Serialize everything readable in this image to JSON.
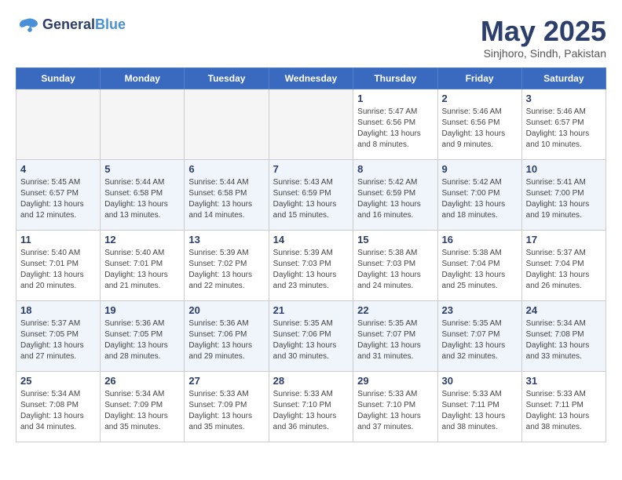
{
  "logo": {
    "line1": "General",
    "line2": "Blue"
  },
  "title": "May 2025",
  "location": "Sinjhoro, Sindh, Pakistan",
  "days_of_week": [
    "Sunday",
    "Monday",
    "Tuesday",
    "Wednesday",
    "Thursday",
    "Friday",
    "Saturday"
  ],
  "weeks": [
    [
      {
        "day": "",
        "info": ""
      },
      {
        "day": "",
        "info": ""
      },
      {
        "day": "",
        "info": ""
      },
      {
        "day": "",
        "info": ""
      },
      {
        "day": "1",
        "info": "Sunrise: 5:47 AM\nSunset: 6:56 PM\nDaylight: 13 hours\nand 8 minutes."
      },
      {
        "day": "2",
        "info": "Sunrise: 5:46 AM\nSunset: 6:56 PM\nDaylight: 13 hours\nand 9 minutes."
      },
      {
        "day": "3",
        "info": "Sunrise: 5:46 AM\nSunset: 6:57 PM\nDaylight: 13 hours\nand 10 minutes."
      }
    ],
    [
      {
        "day": "4",
        "info": "Sunrise: 5:45 AM\nSunset: 6:57 PM\nDaylight: 13 hours\nand 12 minutes."
      },
      {
        "day": "5",
        "info": "Sunrise: 5:44 AM\nSunset: 6:58 PM\nDaylight: 13 hours\nand 13 minutes."
      },
      {
        "day": "6",
        "info": "Sunrise: 5:44 AM\nSunset: 6:58 PM\nDaylight: 13 hours\nand 14 minutes."
      },
      {
        "day": "7",
        "info": "Sunrise: 5:43 AM\nSunset: 6:59 PM\nDaylight: 13 hours\nand 15 minutes."
      },
      {
        "day": "8",
        "info": "Sunrise: 5:42 AM\nSunset: 6:59 PM\nDaylight: 13 hours\nand 16 minutes."
      },
      {
        "day": "9",
        "info": "Sunrise: 5:42 AM\nSunset: 7:00 PM\nDaylight: 13 hours\nand 18 minutes."
      },
      {
        "day": "10",
        "info": "Sunrise: 5:41 AM\nSunset: 7:00 PM\nDaylight: 13 hours\nand 19 minutes."
      }
    ],
    [
      {
        "day": "11",
        "info": "Sunrise: 5:40 AM\nSunset: 7:01 PM\nDaylight: 13 hours\nand 20 minutes."
      },
      {
        "day": "12",
        "info": "Sunrise: 5:40 AM\nSunset: 7:01 PM\nDaylight: 13 hours\nand 21 minutes."
      },
      {
        "day": "13",
        "info": "Sunrise: 5:39 AM\nSunset: 7:02 PM\nDaylight: 13 hours\nand 22 minutes."
      },
      {
        "day": "14",
        "info": "Sunrise: 5:39 AM\nSunset: 7:03 PM\nDaylight: 13 hours\nand 23 minutes."
      },
      {
        "day": "15",
        "info": "Sunrise: 5:38 AM\nSunset: 7:03 PM\nDaylight: 13 hours\nand 24 minutes."
      },
      {
        "day": "16",
        "info": "Sunrise: 5:38 AM\nSunset: 7:04 PM\nDaylight: 13 hours\nand 25 minutes."
      },
      {
        "day": "17",
        "info": "Sunrise: 5:37 AM\nSunset: 7:04 PM\nDaylight: 13 hours\nand 26 minutes."
      }
    ],
    [
      {
        "day": "18",
        "info": "Sunrise: 5:37 AM\nSunset: 7:05 PM\nDaylight: 13 hours\nand 27 minutes."
      },
      {
        "day": "19",
        "info": "Sunrise: 5:36 AM\nSunset: 7:05 PM\nDaylight: 13 hours\nand 28 minutes."
      },
      {
        "day": "20",
        "info": "Sunrise: 5:36 AM\nSunset: 7:06 PM\nDaylight: 13 hours\nand 29 minutes."
      },
      {
        "day": "21",
        "info": "Sunrise: 5:35 AM\nSunset: 7:06 PM\nDaylight: 13 hours\nand 30 minutes."
      },
      {
        "day": "22",
        "info": "Sunrise: 5:35 AM\nSunset: 7:07 PM\nDaylight: 13 hours\nand 31 minutes."
      },
      {
        "day": "23",
        "info": "Sunrise: 5:35 AM\nSunset: 7:07 PM\nDaylight: 13 hours\nand 32 minutes."
      },
      {
        "day": "24",
        "info": "Sunrise: 5:34 AM\nSunset: 7:08 PM\nDaylight: 13 hours\nand 33 minutes."
      }
    ],
    [
      {
        "day": "25",
        "info": "Sunrise: 5:34 AM\nSunset: 7:08 PM\nDaylight: 13 hours\nand 34 minutes."
      },
      {
        "day": "26",
        "info": "Sunrise: 5:34 AM\nSunset: 7:09 PM\nDaylight: 13 hours\nand 35 minutes."
      },
      {
        "day": "27",
        "info": "Sunrise: 5:33 AM\nSunset: 7:09 PM\nDaylight: 13 hours\nand 35 minutes."
      },
      {
        "day": "28",
        "info": "Sunrise: 5:33 AM\nSunset: 7:10 PM\nDaylight: 13 hours\nand 36 minutes."
      },
      {
        "day": "29",
        "info": "Sunrise: 5:33 AM\nSunset: 7:10 PM\nDaylight: 13 hours\nand 37 minutes."
      },
      {
        "day": "30",
        "info": "Sunrise: 5:33 AM\nSunset: 7:11 PM\nDaylight: 13 hours\nand 38 minutes."
      },
      {
        "day": "31",
        "info": "Sunrise: 5:33 AM\nSunset: 7:11 PM\nDaylight: 13 hours\nand 38 minutes."
      }
    ]
  ]
}
